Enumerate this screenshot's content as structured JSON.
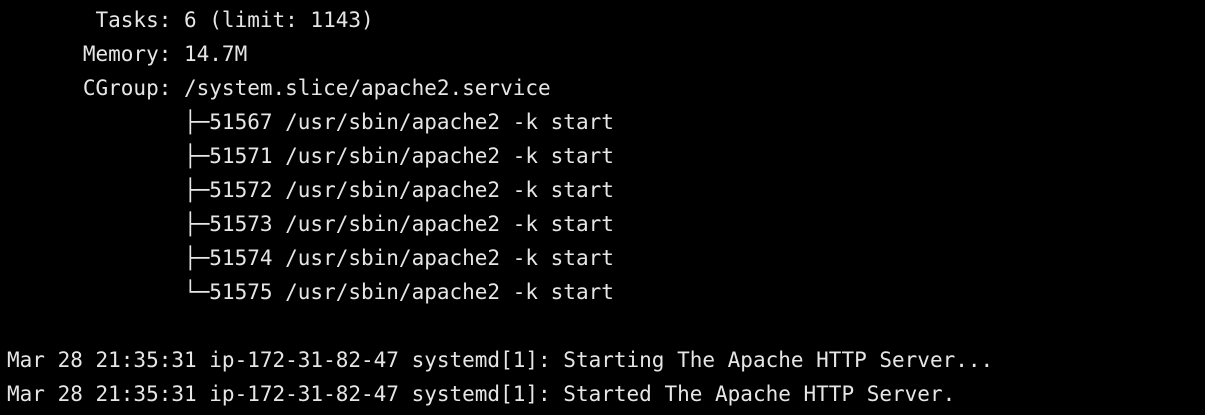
{
  "status": {
    "tasks": "       Tasks: 6 (limit: 1143)",
    "memory": "      Memory: 14.7M",
    "cgroup": "      CGroup: /system.slice/apache2.service"
  },
  "processes": [
    "              ├─51567 /usr/sbin/apache2 -k start",
    "              ├─51571 /usr/sbin/apache2 -k start",
    "              ├─51572 /usr/sbin/apache2 -k start",
    "              ├─51573 /usr/sbin/apache2 -k start",
    "              ├─51574 /usr/sbin/apache2 -k start",
    "              └─51575 /usr/sbin/apache2 -k start"
  ],
  "log": [
    "Mar 28 21:35:31 ip-172-31-82-47 systemd[1]: Starting The Apache HTTP Server...",
    "Mar 28 21:35:31 ip-172-31-82-47 systemd[1]: Started The Apache HTTP Server."
  ],
  "colors": {
    "background": "#000000",
    "foreground": "#e6e6e6"
  }
}
